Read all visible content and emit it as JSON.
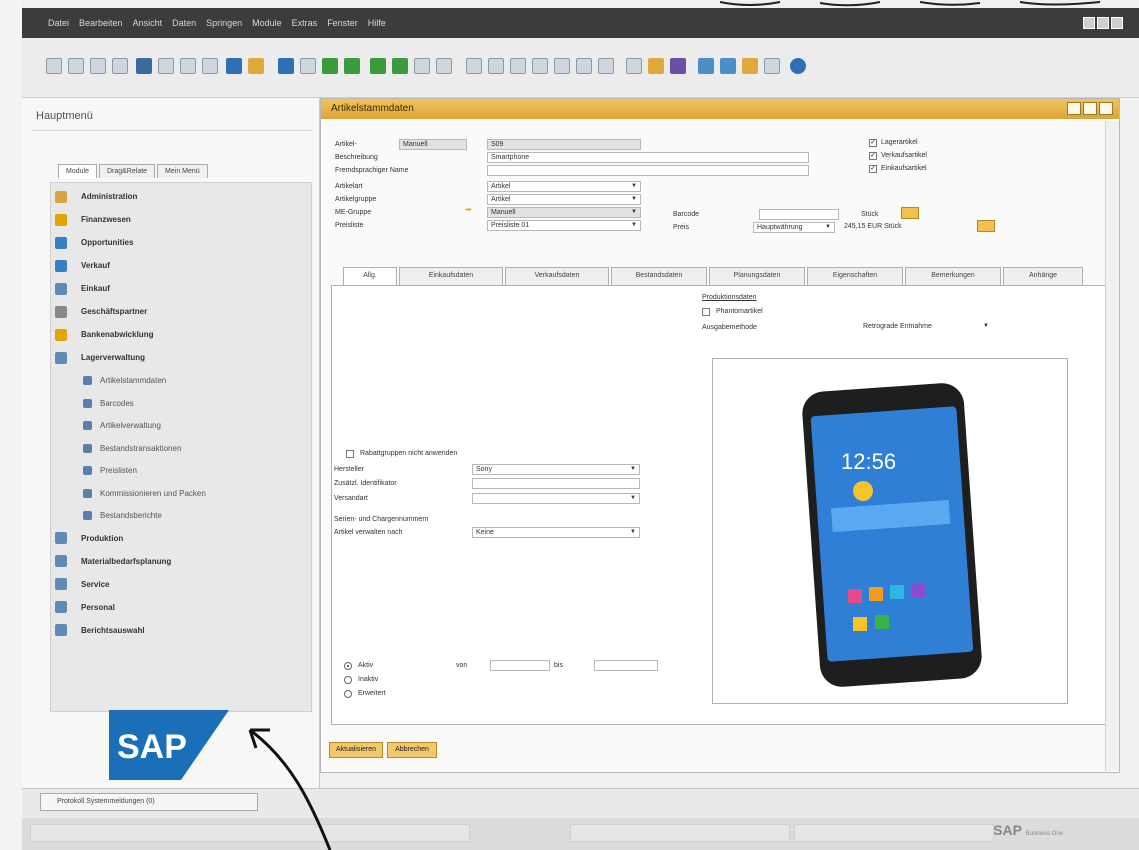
{
  "menubar": {
    "items": [
      "Datei",
      "Bearbeiten",
      "Ansicht",
      "Daten",
      "Springen",
      "Module",
      "Extras",
      "Fenster",
      "Hilfe"
    ]
  },
  "main_menu": {
    "title": "Hauptmenü",
    "tabs": [
      "Module",
      "Drag&Relate",
      "Mein Menü"
    ],
    "items": [
      {
        "label": "Administration",
        "icon": "administration-icon",
        "color": "#d9a540"
      },
      {
        "label": "Finanzwesen",
        "icon": "finance-icon",
        "color": "#e3a400"
      },
      {
        "label": "Opportunities",
        "icon": "opportunities-icon",
        "color": "#3a7fc1"
      },
      {
        "label": "Verkauf",
        "icon": "sales-icon",
        "color": "#3a7fc1"
      },
      {
        "label": "Einkauf",
        "icon": "purchasing-icon",
        "color": "#5f8cb6"
      },
      {
        "label": "Geschäftspartner",
        "icon": "business-partner-icon",
        "color": "#888888"
      },
      {
        "label": "Bankenabwicklung",
        "icon": "banking-icon",
        "color": "#e3a400"
      },
      {
        "label": "Lagerverwaltung",
        "icon": "inventory-icon",
        "color": "#5f8cb6"
      }
    ],
    "subitems": [
      "Artikelstammdaten",
      "Barcodes",
      "Artikelverwaltung",
      "Bestandstransaktionen",
      "Preislisten",
      "Kommissionieren und Packen",
      "Bestandsberichte"
    ],
    "items_after": [
      {
        "label": "Produktion",
        "icon": "production-icon",
        "color": "#5f8cb6"
      },
      {
        "label": "Materialbedarfsplanung",
        "icon": "mrp-icon",
        "color": "#5f8cb6"
      },
      {
        "label": "Service",
        "icon": "service-icon",
        "color": "#5f8cb6"
      },
      {
        "label": "Personal",
        "icon": "personnel-icon",
        "color": "#5f8cb6"
      },
      {
        "label": "Berichtsauswahl",
        "icon": "report-icon",
        "color": "#5f8cb6"
      }
    ]
  },
  "item_window": {
    "title": "Artikelstammdaten",
    "header": {
      "item_no_label": "Artikel-",
      "item_no_mode": "Manuell",
      "item_no_value": "S09",
      "description_label": "Beschreibung",
      "description_value": "Smartphone",
      "foreign_name_label": "Fremdsprachiger Name",
      "item_type_label": "Artikelart",
      "item_type_value": "Artikel",
      "item_group_label": "Artikelgruppe",
      "item_group_value": "Artikel",
      "uom_group_label": "ME-Gruppe",
      "uom_group_value": "Manuell",
      "price_list_label": "Preisliste",
      "price_list_value": "Preisliste 01",
      "barcode_label": "Barcode",
      "unit_label": "Stück",
      "price_label": "Preis",
      "price_currency": "Hauptwährung",
      "price_value": "245,15 EUR Stück",
      "checkboxes": [
        "Lagerartikel",
        "Verkaufsartikel",
        "Einkaufsartikel"
      ]
    },
    "tabs": [
      "Allg.",
      "Einkaufsdaten",
      "Verkaufsdaten",
      "Bestandsdaten",
      "Planungsdaten",
      "Eigenschaften",
      "Bemerkungen",
      "Anhänge"
    ],
    "general": {
      "no_discount_label": "Rabattgruppen nicht anwenden",
      "manufacturer_label": "Hersteller",
      "manufacturer_value": "Sony",
      "addl_id_label": "Zusätzl. Identifikator",
      "shipping_type_label": "Versandart",
      "serial_batch_label": "Serien- und Chargennummern",
      "manage_by_label": "Artikel verwalten nach",
      "manage_by_value": "Keine",
      "status_active": "Aktiv",
      "status_inactive": "Inaktiv",
      "status_advanced": "Erweitert",
      "from_label": "von",
      "to_label": "bis",
      "production_data_label": "Produktionsdaten",
      "phantom_label": "Phantomartikel",
      "issue_method_label": "Ausgabemethode",
      "issue_method_value": "Retrograde Entnahme"
    },
    "phone": {
      "time": "12:56"
    },
    "buttons": {
      "update": "Aktualisieren",
      "cancel": "Abbrechen"
    }
  },
  "status_tab": {
    "label": "Protokoll Systemmeldungen (0)"
  },
  "brand": {
    "sap": "SAP",
    "sap_one": "SAP",
    "sap_one_sub": "Business One"
  }
}
